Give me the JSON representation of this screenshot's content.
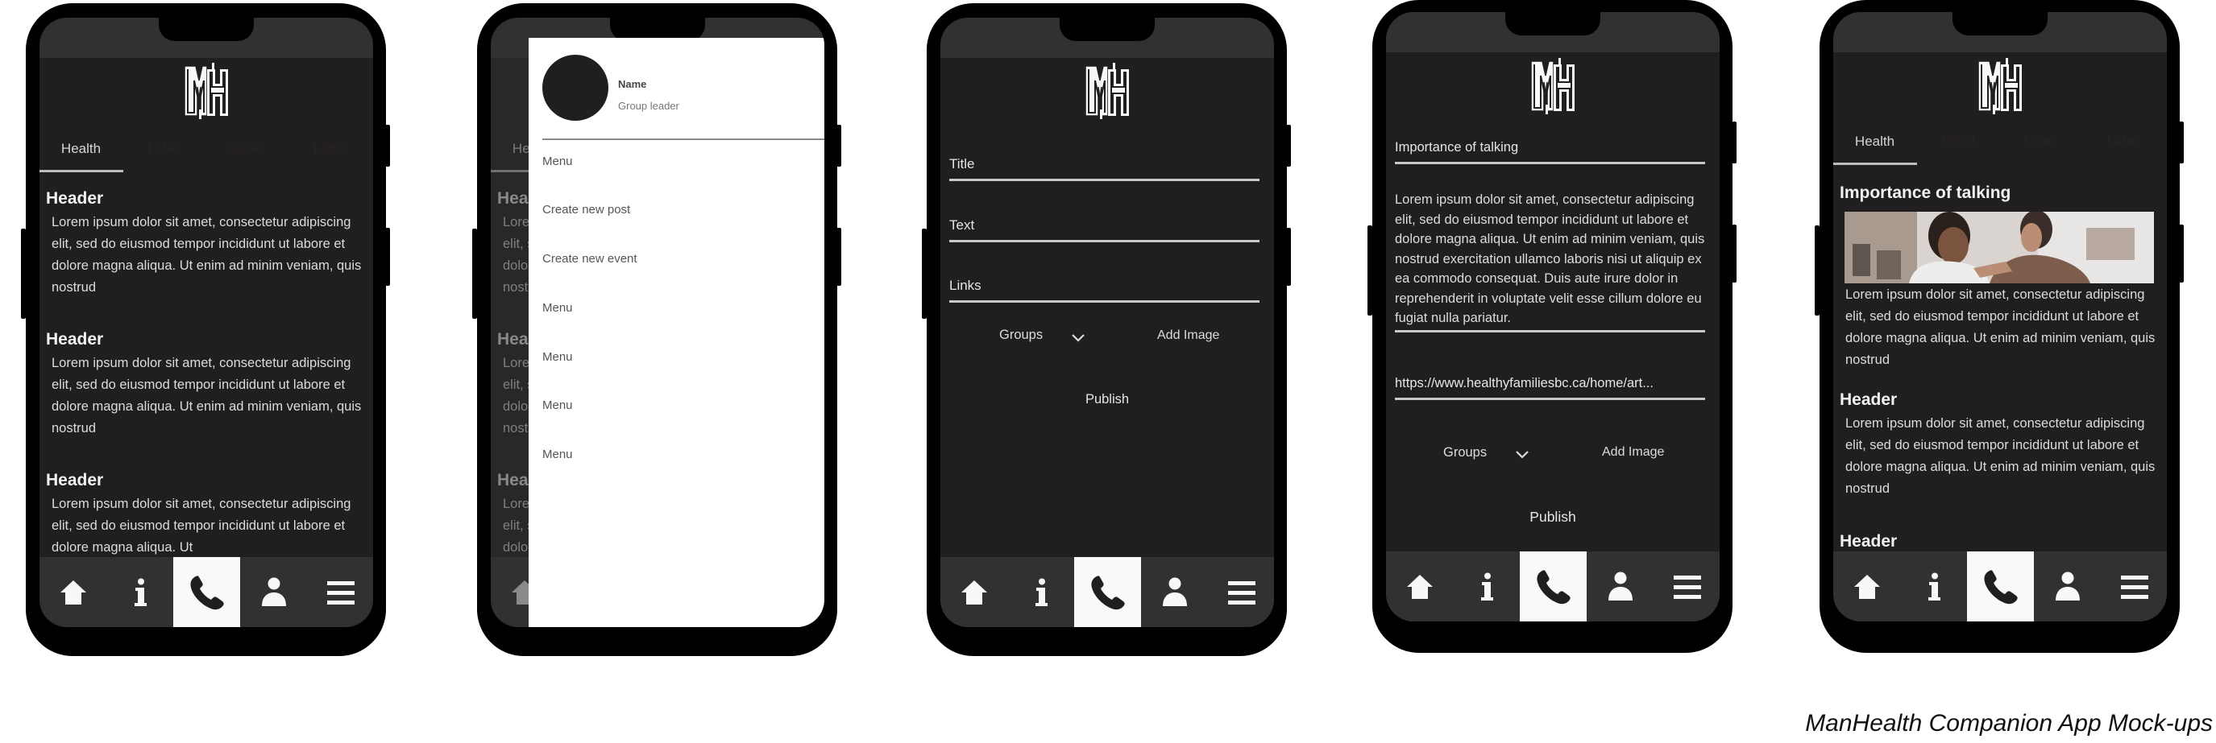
{
  "caption": "ManHealth Companion App Mock-ups",
  "logo_text": "MH",
  "nav": {
    "items": [
      {
        "name": "home",
        "icon": "home-icon"
      },
      {
        "name": "info",
        "icon": "info-icon"
      },
      {
        "name": "call",
        "icon": "phone-icon",
        "active": true
      },
      {
        "name": "profile",
        "icon": "person-icon"
      },
      {
        "name": "menu",
        "icon": "hamburger-menu-icon"
      }
    ]
  },
  "screens": {
    "feed": {
      "tabs": [
        "Health",
        "Label",
        "Label",
        "Label"
      ],
      "active_tab": "Health",
      "articles": [
        {
          "header": "Header",
          "body": "Lorem ipsum dolor sit amet, consectetur adipiscing elit, sed do eiusmod tempor incididunt ut labore et dolore magna aliqua. Ut enim ad minim veniam, quis nostrud"
        },
        {
          "header": "Header",
          "body": "Lorem ipsum dolor sit amet, consectetur adipiscing elit, sed do eiusmod tempor incididunt ut labore et dolore magna aliqua. Ut enim ad minim veniam, quis nostrud"
        },
        {
          "header": "Header",
          "body": "Lorem ipsum dolor sit amet, consectetur adipiscing elit, sed do eiusmod tempor incididunt ut labore et dolore magna aliqua. Ut"
        }
      ]
    },
    "drawer": {
      "profile_name": "Name",
      "profile_role": "Group leader",
      "items": [
        "Menu",
        "Create new post",
        "Create new event",
        "Menu",
        "Menu",
        "Menu",
        "Menu"
      ]
    },
    "create_post_empty": {
      "fields": [
        {
          "label": "Title",
          "value": ""
        },
        {
          "label": "Text",
          "value": ""
        },
        {
          "label": "Links",
          "value": ""
        }
      ],
      "groups_label": "Groups",
      "add_image_label": "Add Image",
      "publish_label": "Publish"
    },
    "create_post_filled": {
      "title_value": "Importance of talking",
      "text_value": "Lorem ipsum dolor sit amet, consectetur adipiscing elit, sed do eiusmod tempor incididunt ut labore et dolore magna aliqua. Ut enim ad minim veniam, quis nostrud exercitation ullamco laboris nisi ut aliquip ex ea commodo consequat. Duis aute irure dolor in reprehenderit in voluptate velit esse cillum dolore eu fugiat nulla pariatur.",
      "link_value": "https://www.healthyfamiliesbc.ca/home/art...",
      "groups_label": "Groups",
      "add_image_label": "Add Image",
      "publish_label": "Publish"
    },
    "feed_published": {
      "tabs": [
        "Health",
        "Label",
        "Label",
        "Label"
      ],
      "active_tab": "Health",
      "articles": [
        {
          "header": "Importance of talking",
          "image": "two men talking outdoors photo",
          "body": "Lorem ipsum dolor sit amet, consectetur adipiscing elit, sed do eiusmod tempor incididunt ut labore et dolore magna aliqua. Ut enim ad minim veniam, quis nostrud"
        },
        {
          "header": "Header",
          "body": "Lorem ipsum dolor sit amet, consectetur adipiscing elit, sed do eiusmod tempor incididunt ut labore et dolore magna aliqua. Ut enim ad minim veniam, quis nostrud"
        },
        {
          "header": "Header",
          "body": ""
        }
      ]
    }
  }
}
